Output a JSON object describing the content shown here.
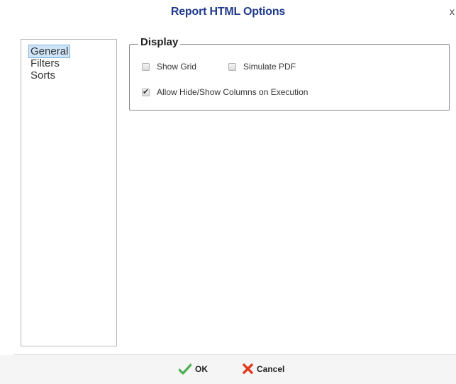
{
  "dialog": {
    "title": "Report HTML Options",
    "close_label": "x"
  },
  "nav": {
    "items": [
      {
        "label": "General",
        "selected": true
      },
      {
        "label": "Filters",
        "selected": false
      },
      {
        "label": "Sorts",
        "selected": false
      }
    ]
  },
  "display": {
    "legend": "Display",
    "options": [
      {
        "label": "Show Grid",
        "checked": false
      },
      {
        "label": "Simulate PDF",
        "checked": false
      },
      {
        "label": "Allow Hide/Show Columns on Execution",
        "checked": true
      }
    ]
  },
  "footer": {
    "ok_label": "OK",
    "cancel_label": "Cancel"
  },
  "colors": {
    "title": "#1f3a8a",
    "ok_icon": "#4caf50",
    "cancel_icon": "#e03a1e",
    "selection": "#cfe4f7"
  }
}
